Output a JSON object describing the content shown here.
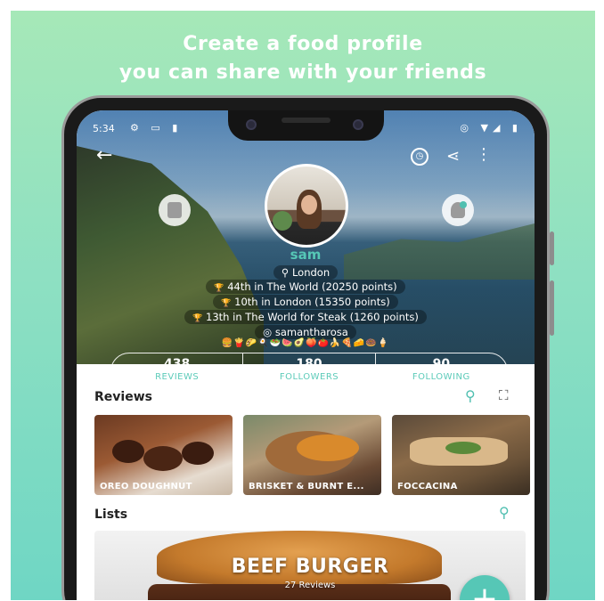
{
  "headline": {
    "line1": "Create a food profile",
    "line2": "you can share with your friends"
  },
  "status_bar": {
    "time": "5:34",
    "left_icons": "⚙ ▭ ▮",
    "right_icons": "◎ ▼◢ ▮"
  },
  "toolbar": {
    "back_icon": "←",
    "history_icon": "◷",
    "share_icon": "⋖",
    "more_icon": "⋮"
  },
  "profile": {
    "username": "sam",
    "location": "London",
    "location_icon": "⚲",
    "trophy_icon": "🏆",
    "rank_world": "44th in The World (20250 points)",
    "rank_city": "10th in London (15350 points)",
    "rank_category": "13th in The World for Steak (1260 points)",
    "instagram_icon": "◎",
    "instagram": "samantharosa",
    "food_emojis": "🍔🍟🌮🍳🥗🍉🥑🍑🍅🍌🍕🧀🍩🍦"
  },
  "stats": [
    {
      "value": "438",
      "label": "REVIEWS"
    },
    {
      "value": "180",
      "label": "FOLLOWERS"
    },
    {
      "value": "90",
      "label": "FOLLOWING"
    }
  ],
  "reviews": {
    "title": "Reviews",
    "search_icon": "⚲",
    "map_icon": "⛶",
    "cards": [
      {
        "label": "OREO DOUGHNUT"
      },
      {
        "label": "BRISKET & BURNT E..."
      },
      {
        "label": "FOCCACINA"
      }
    ]
  },
  "lists": {
    "title": "Lists",
    "search_icon": "⚲",
    "card_title": "BEEF BURGER",
    "card_subtitle": "27 Reviews",
    "fab_icon": "+"
  },
  "colors": {
    "accent": "#56c7b6",
    "background_top": "#a6e8b8",
    "background_bottom": "#6fd6c4"
  }
}
